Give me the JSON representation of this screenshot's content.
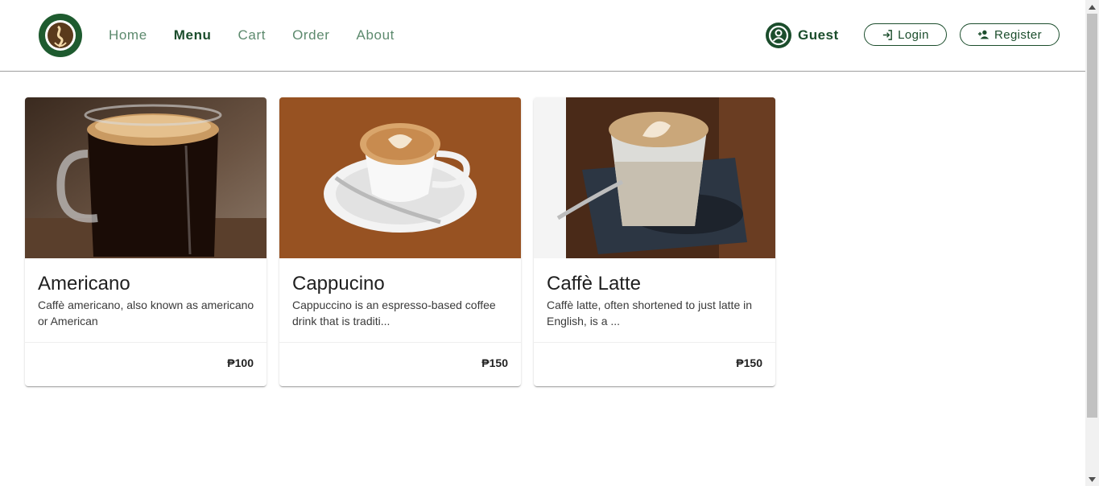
{
  "brand": {
    "logo_text": "COFFEESHOP COMPANY",
    "color": "#1b4d2c"
  },
  "nav": {
    "items": [
      {
        "label": "Home",
        "active": false
      },
      {
        "label": "Menu",
        "active": true
      },
      {
        "label": "Cart",
        "active": false
      },
      {
        "label": "Order",
        "active": false
      },
      {
        "label": "About",
        "active": false
      }
    ]
  },
  "user": {
    "label": "Guest",
    "icon": "account-circle-icon"
  },
  "auth": {
    "login_label": "Login",
    "register_label": "Register"
  },
  "products": [
    {
      "name": "Americano",
      "description": "Caffè americano, also known as americano or American",
      "price": "₱100"
    },
    {
      "name": "Cappucino",
      "description": "Cappuccino is an espresso-based coffee drink that is traditi...",
      "price": "₱150"
    },
    {
      "name": "Caffè Latte",
      "description": "Caffè latte, often shortened to just latte in English, is a ...",
      "price": "₱150"
    }
  ]
}
